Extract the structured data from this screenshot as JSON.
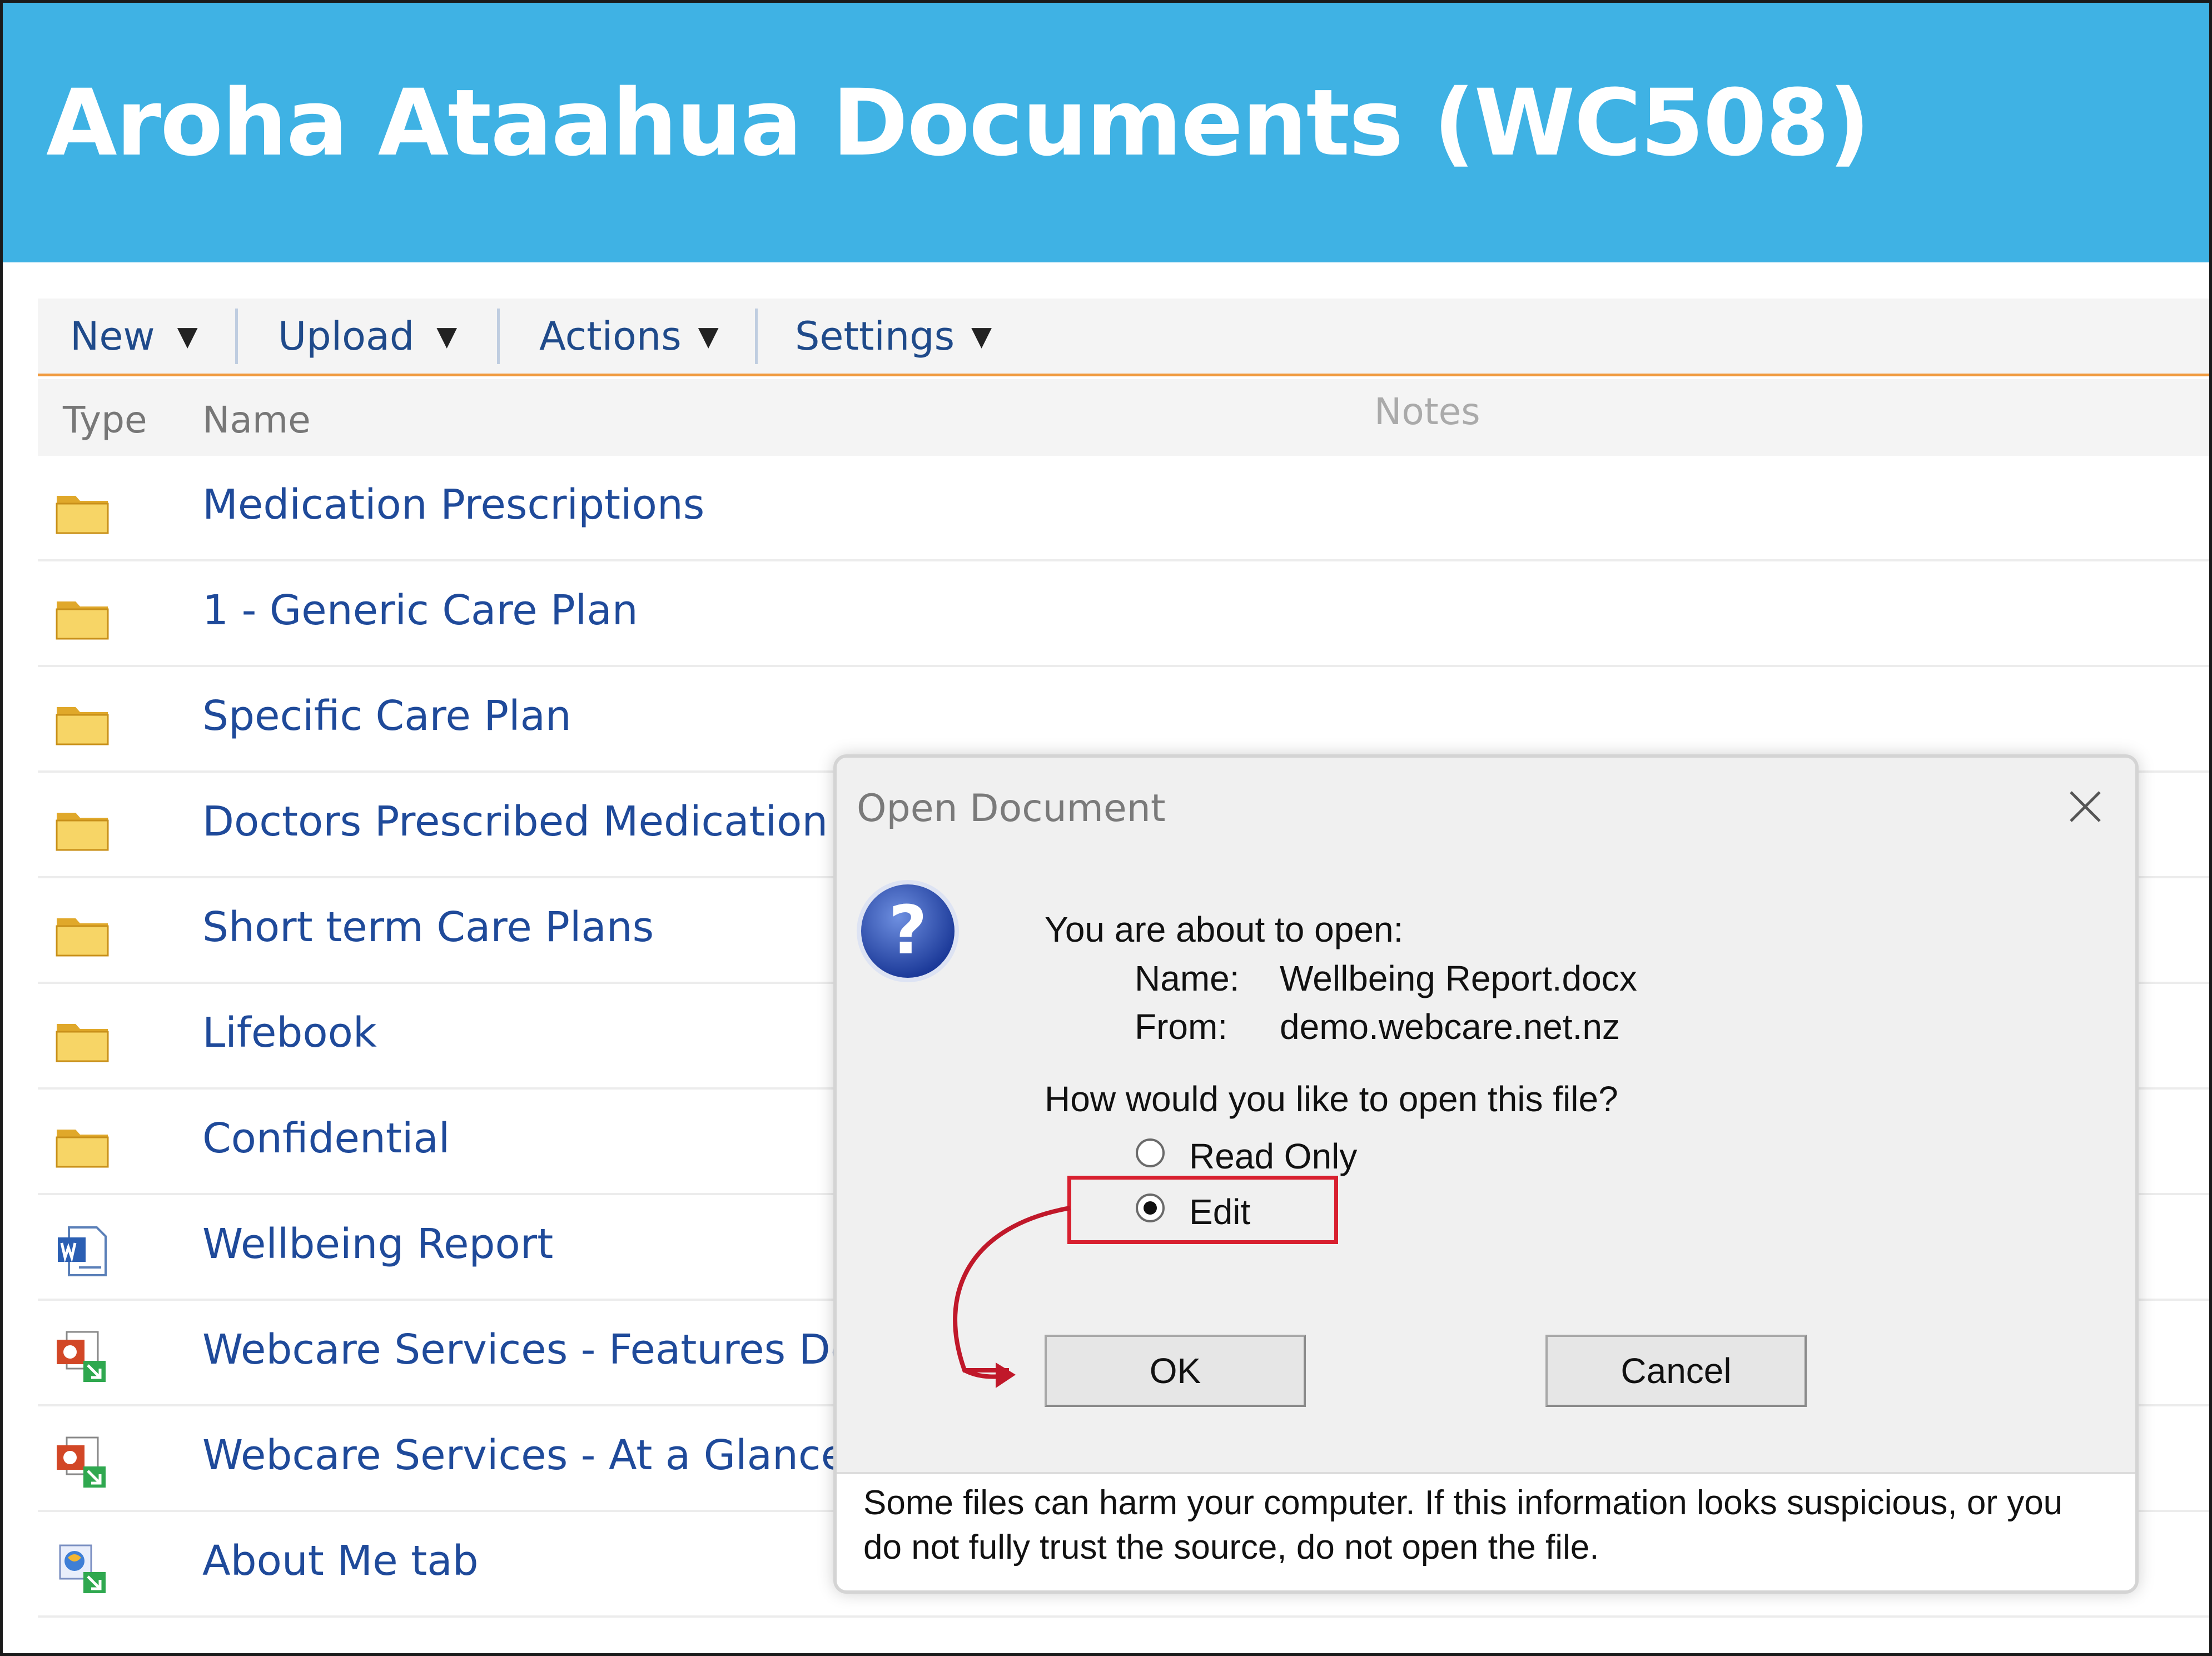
{
  "header": {
    "title": "Aroha Ataahua Documents (WC508)"
  },
  "toolbar": {
    "items": [
      {
        "label": "New"
      },
      {
        "label": "Upload"
      },
      {
        "label": "Actions"
      },
      {
        "label": "Settings"
      }
    ]
  },
  "columns": {
    "type": "Type",
    "name": "Name",
    "notes": "Notes"
  },
  "documents": [
    {
      "name": "Medication Prescriptions",
      "icon": "folder-icon"
    },
    {
      "name": "1 - Generic Care Plan",
      "icon": "folder-icon"
    },
    {
      "name": "Specific Care Plan",
      "icon": "folder-icon"
    },
    {
      "name": "Doctors Prescribed Medication Ch",
      "icon": "folder-icon"
    },
    {
      "name": "Short term Care Plans",
      "icon": "folder-icon"
    },
    {
      "name": "Lifebook",
      "icon": "folder-icon"
    },
    {
      "name": "Confidential",
      "icon": "folder-icon"
    },
    {
      "name": "Wellbeing Report",
      "icon": "word-document-icon"
    },
    {
      "name": "Webcare Services - Features Demo",
      "icon": "presentation-shortcut-icon"
    },
    {
      "name": "Webcare Services - At a Glance",
      "icon": "presentation-shortcut-icon"
    },
    {
      "name": "About Me tab",
      "icon": "web-shortcut-icon"
    }
  ],
  "dialog": {
    "title": "Open Document",
    "intro": "You are about to open:",
    "name_label": "Name:",
    "name_value": "Wellbeing Report.docx",
    "from_label": "From:",
    "from_value": "demo.webcare.net.nz",
    "question": "How would you like to open this file?",
    "options": [
      {
        "label": "Read Only",
        "selected": false
      },
      {
        "label": "Edit",
        "selected": true
      }
    ],
    "ok_label": "OK",
    "cancel_label": "Cancel",
    "warning": "Some files can harm your computer. If this information looks suspicious, or you do not fully trust the source, do not open the file."
  },
  "colors": {
    "header_bg": "#3fb2e4",
    "link_blue": "#1f4a9a",
    "toolbar_underline": "#f09a3e",
    "callout_red": "#d8202f"
  }
}
